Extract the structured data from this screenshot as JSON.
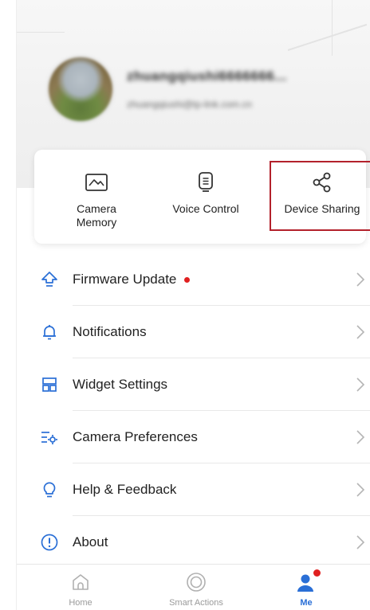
{
  "colors": {
    "accent": "#2a6fd6",
    "badge_red": "#e02020",
    "highlight": "#b3212b"
  },
  "profile": {
    "name": "zhuangqiushi6666666...",
    "email": "zhuangqiushi@tp-link.com.cn"
  },
  "quick_actions": [
    {
      "label": "Camera\nMemory",
      "icon": "camera-memory-icon"
    },
    {
      "label": "Voice Control",
      "icon": "voice-control-icon"
    },
    {
      "label": "Device Sharing",
      "icon": "share-icon"
    }
  ],
  "menu": [
    {
      "label": "Firmware Update",
      "icon": "firmware-update-icon",
      "has_dot": true
    },
    {
      "label": "Notifications",
      "icon": "bell-icon"
    },
    {
      "label": "Widget Settings",
      "icon": "widget-icon"
    },
    {
      "label": "Camera Preferences",
      "icon": "camera-preferences-icon"
    },
    {
      "label": "Help & Feedback",
      "icon": "lightbulb-icon"
    },
    {
      "label": "About",
      "icon": "info-icon"
    }
  ],
  "tabs": [
    {
      "label": "Home",
      "icon": "home-icon"
    },
    {
      "label": "Smart Actions",
      "icon": "smart-actions-icon"
    },
    {
      "label": "Me",
      "icon": "me-icon",
      "active": true
    }
  ]
}
